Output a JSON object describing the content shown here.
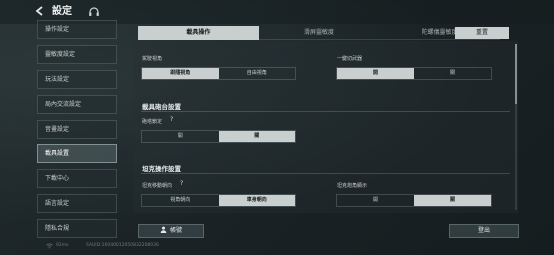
{
  "header": {
    "title": "設定",
    "back_icon": "arrow-left-icon",
    "support_icon": "headset-icon"
  },
  "tabs": [
    {
      "label": "載具操作",
      "active": true
    },
    {
      "label": "滑屏靈敏度",
      "active": false
    },
    {
      "label": "陀螺儀靈敏度",
      "active": false
    }
  ],
  "reset_label": "重置",
  "sidebar": {
    "items": [
      {
        "label": "操作設定"
      },
      {
        "label": "靈敏度設定"
      },
      {
        "label": "玩法設定"
      },
      {
        "label": "局內交流設定"
      },
      {
        "label": "音畫設定"
      },
      {
        "label": "載具設置",
        "active": true
      },
      {
        "label": "下載中心"
      },
      {
        "label": "語言設定"
      },
      {
        "label": "隱私合規"
      }
    ]
  },
  "settings": {
    "driving_view": {
      "label": "駕駛視角",
      "options": [
        "跟隨視角",
        "自由視角"
      ],
      "selected": 0
    },
    "one_key_weapon": {
      "label": "一鍵切武器",
      "options": [
        "開",
        "關"
      ],
      "selected": 0
    },
    "turret_section": {
      "title": "載具砲台設置"
    },
    "aim_lock": {
      "label": "砲塔鎖定",
      "help": "?",
      "options": [
        "開",
        "關"
      ],
      "selected": 1
    },
    "tank_section": {
      "title": "坦克操作設置"
    },
    "tank_move_dir": {
      "label": "坦克移動朝向",
      "help": "?",
      "options": [
        "視角朝向",
        "車身朝向"
      ],
      "selected": 1
    },
    "tank_angle_display": {
      "label": "坦克炮角顯示",
      "options": [
        "開",
        "關"
      ],
      "selected": 1
    }
  },
  "footer": {
    "account_label": "帳號",
    "account_icon": "user-icon",
    "logout_label": "登出",
    "ping": "92ms",
    "uid": "SAUID:16040012050832208036"
  }
}
